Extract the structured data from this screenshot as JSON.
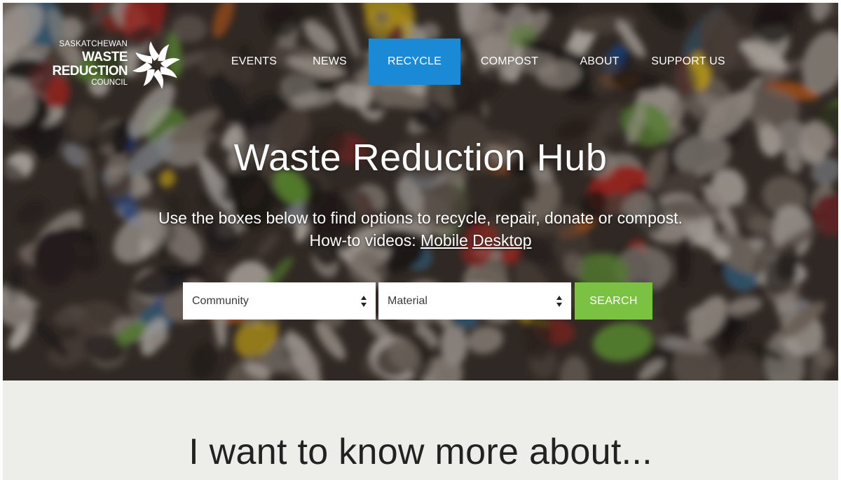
{
  "header": {
    "logo": {
      "line1": "SASKATCHEWAN",
      "line2": "WASTE",
      "line3": "REDUCTION",
      "line4": "COUNCIL",
      "icon": "pinwheel-logo-icon"
    },
    "nav": [
      {
        "label": "EVENTS",
        "active": false
      },
      {
        "label": "NEWS",
        "active": false
      },
      {
        "label": "RECYCLE",
        "active": true
      },
      {
        "label": "COMPOST",
        "active": false
      },
      {
        "label": "ABOUT",
        "active": false
      },
      {
        "label": "SUPPORT US",
        "active": false
      }
    ]
  },
  "hero": {
    "title": "Waste Reduction Hub",
    "subtitle_part1": "Use the boxes below to find options to recycle, repair, donate or compost. How-to videos:",
    "link_mobile": "Mobile",
    "link_desktop": "Desktop",
    "search": {
      "community_value": "Community",
      "material_value": "Material",
      "button_label": "SEARCH"
    }
  },
  "lower": {
    "title": "I want to know more about..."
  },
  "colors": {
    "nav_active": "#1a8ad6",
    "search_button": "#7cc242",
    "lower_background": "#ededea"
  }
}
